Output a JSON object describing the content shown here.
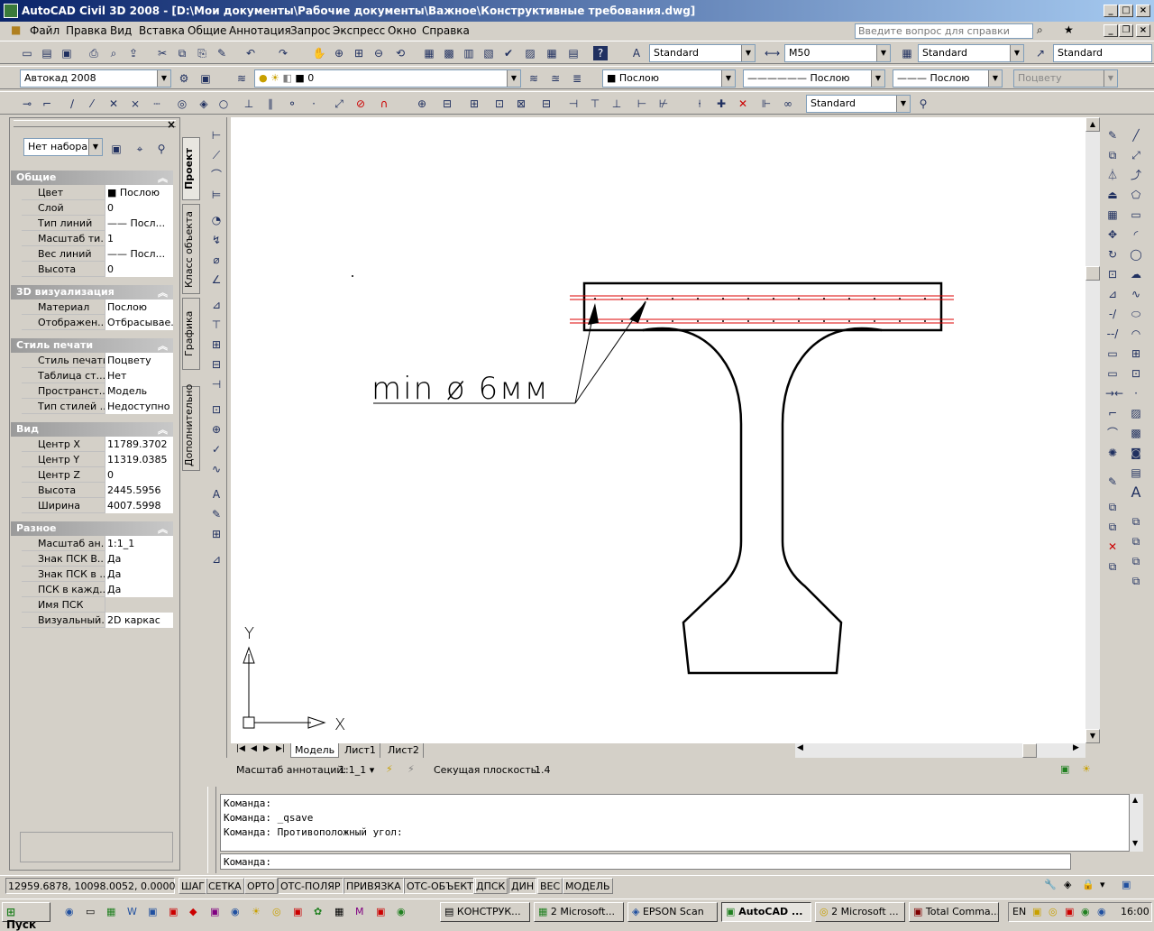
{
  "window": {
    "title": "AutoCAD Civil 3D 2008 - [D:\\Мои документы\\Рабочие документы\\Важное\\Конструктивные требования.dwg]"
  },
  "menu": [
    "Файл",
    "Правка",
    "Вид",
    "Вставка",
    "Общие",
    "Аннотация",
    "Запрос",
    "Экспресс",
    "Окно",
    "Справка"
  ],
  "help_placeholder": "Введите вопрос для справки",
  "toolbar1": {
    "text_style": "Standard",
    "dim_style": "M50",
    "table_style": "Standard",
    "mleader_style": "Standard"
  },
  "toolbar2": {
    "workspace": "Автокад 2008",
    "layer": "0",
    "color": "Послою",
    "linetype": "Послою",
    "lineweight": "Послою",
    "plotstyle": "Поцвету"
  },
  "toolbar3": {
    "dim_style": "Standard"
  },
  "palette": {
    "selection": "Нет набора",
    "sections": [
      {
        "title": "Общие",
        "rows": [
          {
            "k": "Цвет",
            "v": "Послою"
          },
          {
            "k": "Слой",
            "v": "0"
          },
          {
            "k": "Тип линий",
            "v": "—— Посл..."
          },
          {
            "k": "Масштаб ти...",
            "v": "1"
          },
          {
            "k": "Вес линий",
            "v": "—— Посл..."
          },
          {
            "k": "Высота",
            "v": "0"
          }
        ]
      },
      {
        "title": "3D визуализация",
        "rows": [
          {
            "k": "Материал",
            "v": "Послою"
          },
          {
            "k": "Отображен...",
            "v": "Отбрасывае..."
          }
        ]
      },
      {
        "title": "Стиль печати",
        "rows": [
          {
            "k": "Стиль печати",
            "v": "Поцвету"
          },
          {
            "k": "Таблица ст...",
            "v": "Нет"
          },
          {
            "k": "Пространст...",
            "v": "Модель"
          },
          {
            "k": "Тип стилей ...",
            "v": "Недоступно"
          }
        ]
      },
      {
        "title": "Вид",
        "rows": [
          {
            "k": "Центр X",
            "v": "11789.3702"
          },
          {
            "k": "Центр Y",
            "v": "11319.0385"
          },
          {
            "k": "Центр Z",
            "v": "0"
          },
          {
            "k": "Высота",
            "v": "2445.5956"
          },
          {
            "k": "Ширина",
            "v": "4007.5998"
          }
        ]
      },
      {
        "title": "Разное",
        "rows": [
          {
            "k": "Масштаб ан...",
            "v": "1:1_1"
          },
          {
            "k": "Знак ПСК В...",
            "v": "Да"
          },
          {
            "k": "Знак ПСК в ...",
            "v": "Да"
          },
          {
            "k": "ПСК в кажд...",
            "v": "Да"
          },
          {
            "k": "Имя ПСК",
            "v": ""
          },
          {
            "k": "Визуальный...",
            "v": "2D каркас"
          }
        ]
      }
    ],
    "vtabs": [
      "Проект",
      "Класс объекта",
      "Графика",
      "Дополнительно"
    ]
  },
  "drawing": {
    "annotation": "min  ø  6мм",
    "axis_x": "X",
    "axis_y": "Y"
  },
  "layout_tabs": [
    "Модель",
    "Лист1",
    "Лист2"
  ],
  "annotation_bar": {
    "scale_label": "Масштаб аннотаций:",
    "scale_value": "1:1_1",
    "section_label": "Секущая плоскость:",
    "section_value": "1.4"
  },
  "command": {
    "history": [
      "Команда:",
      "Команда: _qsave",
      "Команда: Противоположный угол:"
    ],
    "prompt": "Команда:"
  },
  "status": {
    "coords": "12959.6878, 10098.0052, 0.0000",
    "toggles": [
      "ШАГ",
      "СЕТКА",
      "ОРТО",
      "ОТС-ПОЛЯР",
      "ПРИВЯЗКА",
      "ОТС-ОБЪЕКТ",
      "ДПСК",
      "ДИН",
      "ВЕС",
      "МОДЕЛЬ"
    ]
  },
  "taskbar": {
    "start": "Пуск",
    "tasks": [
      "КОНСТРУК...",
      "2 Microsoft...",
      "EPSON Scan",
      "AutoCAD ...",
      "2 Microsoft ...",
      "Total Comma..."
    ],
    "lang": "EN",
    "clock": "16:00"
  }
}
